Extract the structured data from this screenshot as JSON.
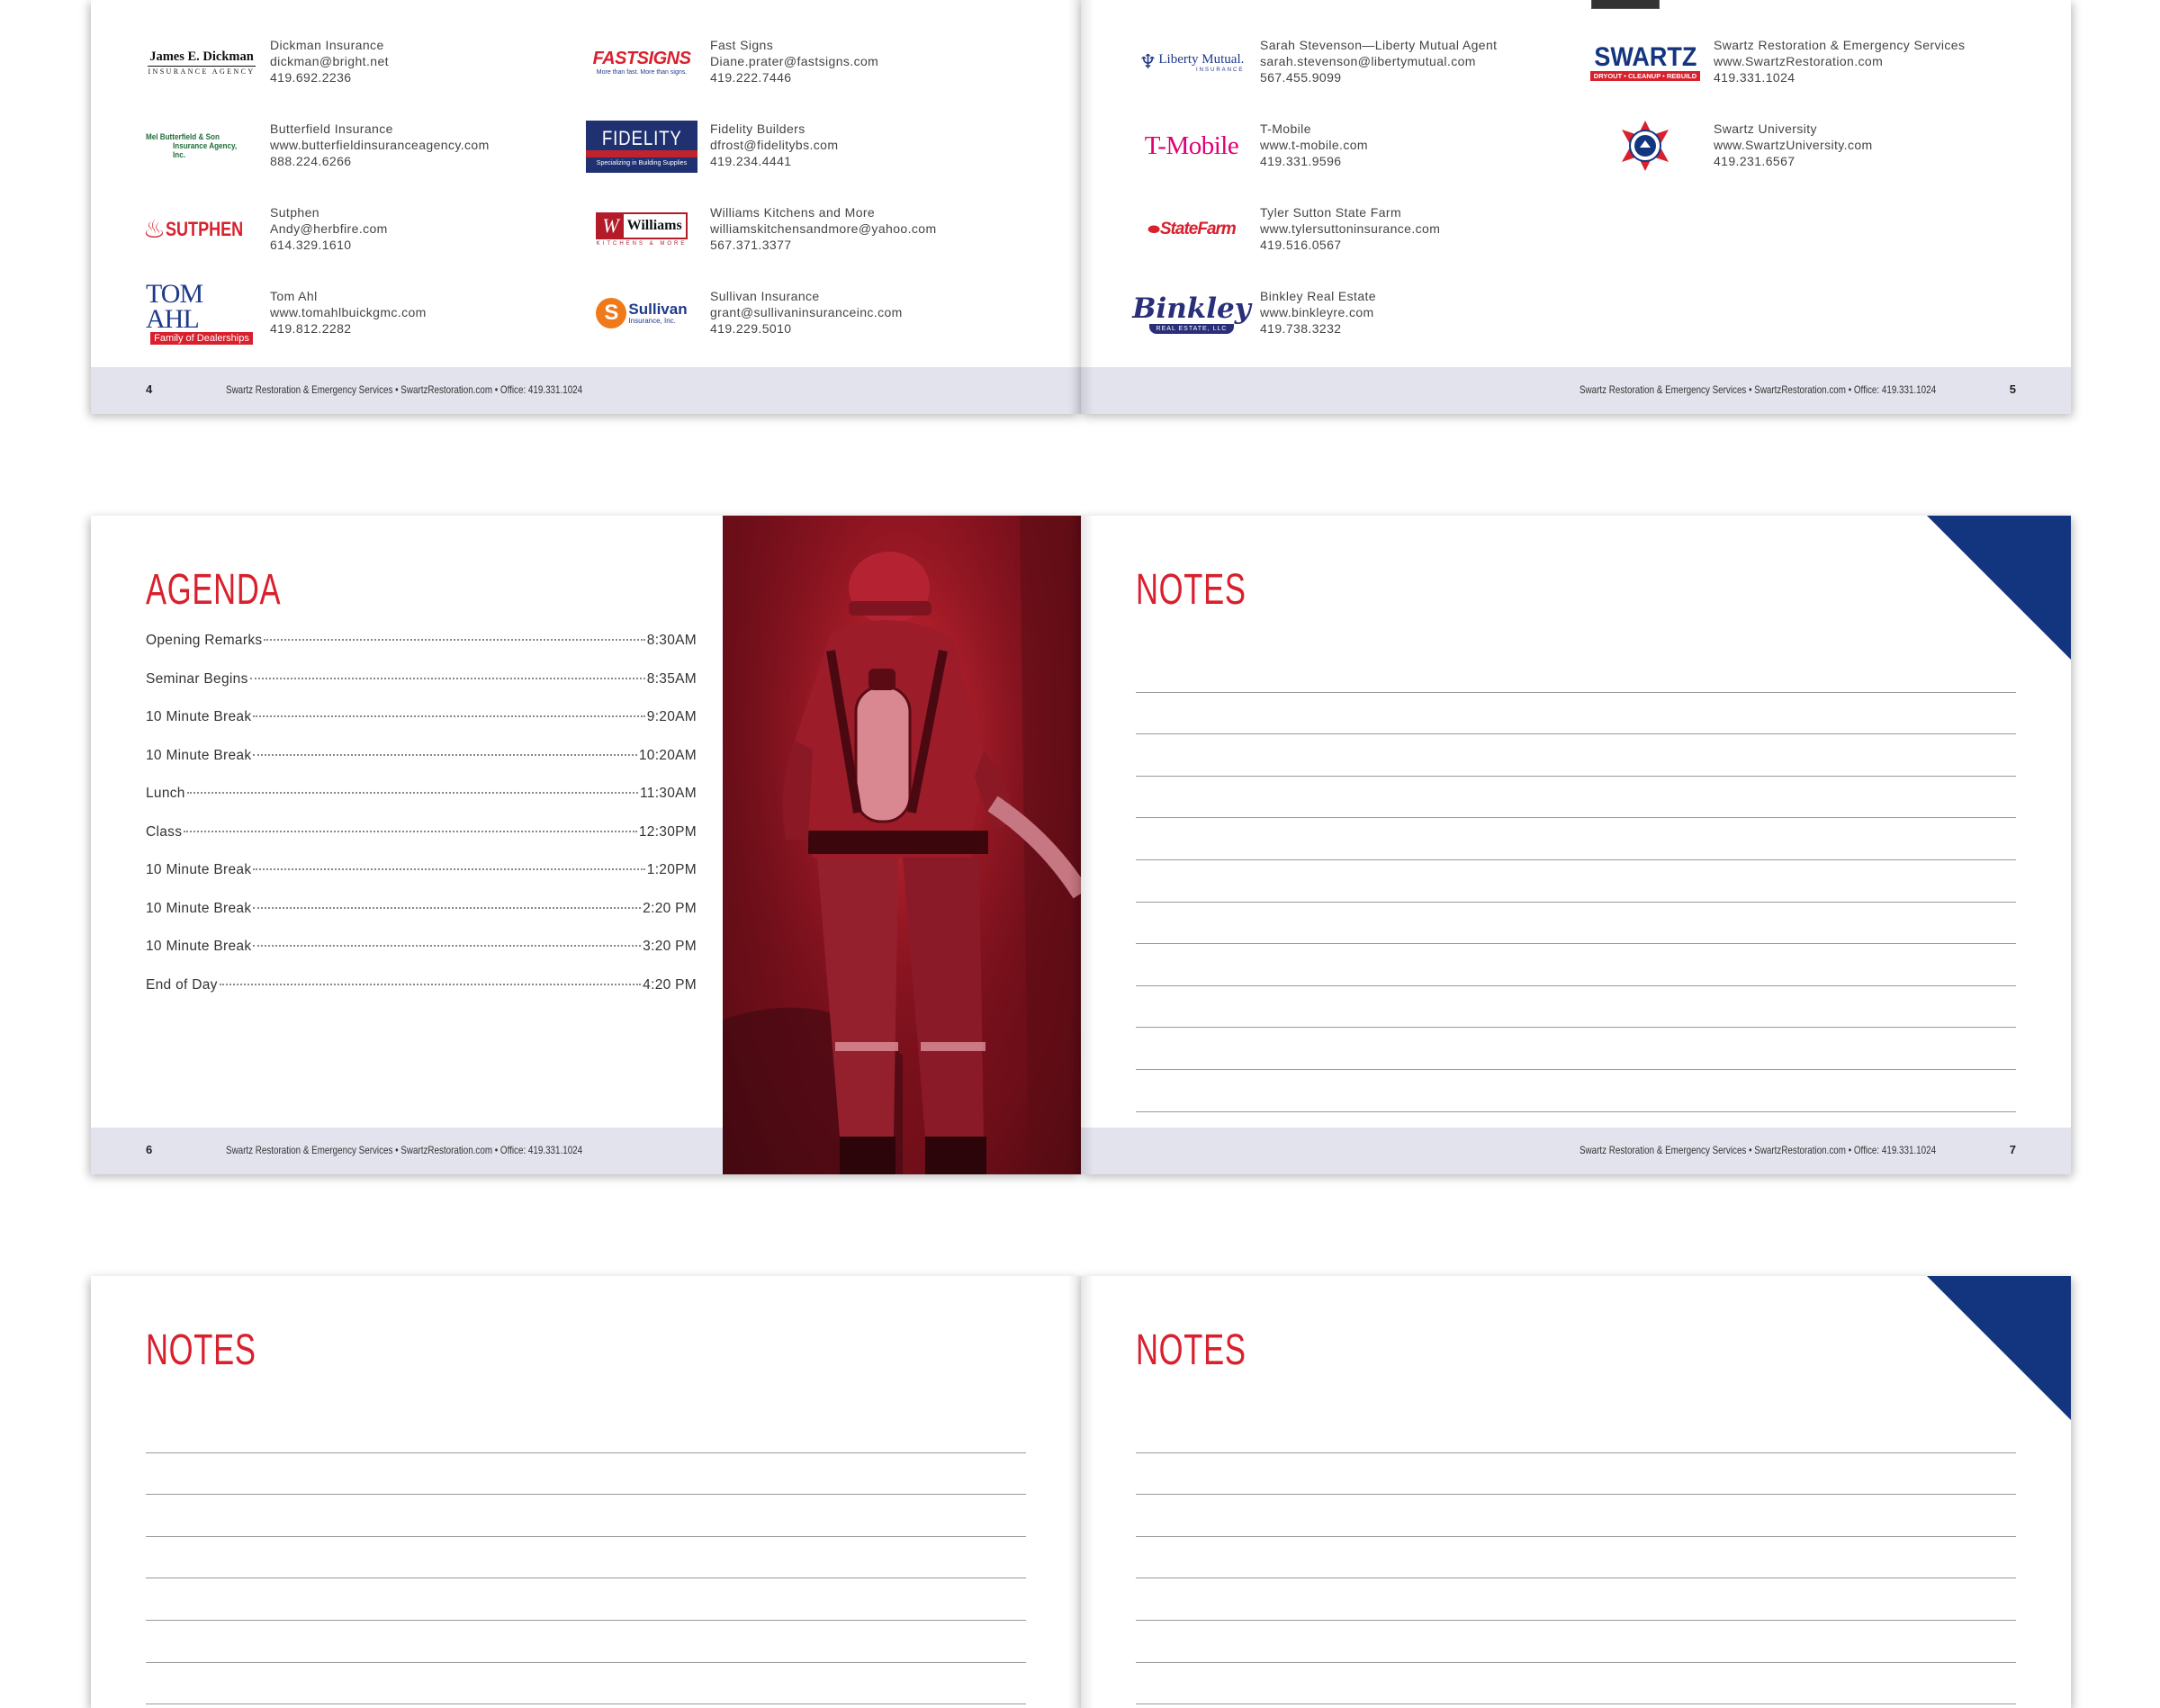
{
  "footer_text": "Swartz Restoration & Emergency Services  •  SwartzRestoration.com  •  Office: 419.331.1024",
  "spread1": {
    "left_page_number": "4",
    "right_page_number": "5",
    "left_sponsors": [
      {
        "name": "Dickman Insurance",
        "contact": "dickman@bright.net",
        "phone": "419.692.2236",
        "logo": {
          "line1": "James E. Dickman",
          "line2": "INSURANCE AGENCY"
        }
      },
      {
        "name": "Butterfield Insurance",
        "contact": "www.butterfieldinsuranceagency.com",
        "phone": "888.224.6266",
        "logo": {
          "line1": "Mel Butterfield & Son",
          "line2": "Insurance Agency, Inc."
        }
      },
      {
        "name": "Sutphen",
        "contact": "Andy@herbfire.com",
        "phone": "614.329.1610",
        "logo": {
          "line1": "SUTPHEN"
        }
      },
      {
        "name": "Tom Ahl",
        "contact": "www.tomahlbuickgmc.com",
        "phone": "419.812.2282",
        "logo": {
          "line1": "TOM AHL",
          "line2": "Family of Dealerships"
        }
      }
    ],
    "middle_sponsors": [
      {
        "name": "Fast Signs",
        "contact": "Diane.prater@fastsigns.com",
        "phone": "419.222.7446",
        "logo": {
          "line1": "FASTSIGNS",
          "line2": "More than fast. More than signs."
        }
      },
      {
        "name": "Fidelity Builders",
        "contact": "dfrost@fidelitybs.com",
        "phone": "419.234.4441",
        "logo": {
          "line1": "FIDELITY",
          "line2": "Specializing in Building Supplies"
        }
      },
      {
        "name": "Williams Kitchens and More",
        "contact": "williamskitchensandmore@yahoo.com",
        "phone": "567.371.3377",
        "logo": {
          "line1": "Williams",
          "line2": "KITCHENS & MORE"
        }
      },
      {
        "name": "Sullivan Insurance",
        "contact": "grant@sullivaninsuranceinc.com",
        "phone": "419.229.5010",
        "logo": {
          "line1": "Sullivan",
          "line2": "Insurance, Inc."
        }
      }
    ],
    "right_sponsors": [
      {
        "name": "Sarah Stevenson—Liberty Mutual Agent",
        "contact": "sarah.stevenson@libertymutual.com",
        "phone": "567.455.9099",
        "logo": {
          "line1": "Liberty Mutual.",
          "line2": "INSURANCE"
        }
      },
      {
        "name": "T-Mobile",
        "contact": "www.t-mobile.com",
        "phone": "419.331.9596",
        "logo": {
          "line1": "T-Mobile"
        }
      },
      {
        "name": "Tyler Sutton State Farm",
        "contact": "www.tylersuttoninsurance.com",
        "phone": "419.516.0567",
        "logo": {
          "line1": "StateFarm"
        }
      },
      {
        "name": "Binkley Real Estate",
        "contact": "www.binkleyre.com",
        "phone": "419.738.3232",
        "logo": {
          "line1": "Binkley",
          "line2": "REAL ESTATE, LLC"
        }
      }
    ],
    "far_right_sponsors": [
      {
        "name": "Swartz Restoration & Emergency Services",
        "contact": "www.SwartzRestoration.com",
        "phone": "419.331.1024",
        "logo": {
          "line1": "SWARTZ",
          "line2": "DRYOUT • CLEANUP • REBUILD"
        }
      },
      {
        "name": "Swartz University",
        "contact": "www.SwartzUniversity.com",
        "phone": "419.231.6567"
      }
    ]
  },
  "spread2": {
    "left_page_number": "6",
    "right_page_number": "7",
    "agenda_title": "AGENDA",
    "agenda": [
      {
        "item": "Opening Remarks",
        "time": "8:30AM"
      },
      {
        "item": "Seminar Begins",
        "time": "8:35AM"
      },
      {
        "item": "10 Minute Break",
        "time": "9:20AM"
      },
      {
        "item": "10 Minute Break",
        "time": "10:20AM"
      },
      {
        "item": "Lunch",
        "time": "11:30AM"
      },
      {
        "item": "Class",
        "time": "12:30PM"
      },
      {
        "item": "10 Minute Break",
        "time": "1:20PM"
      },
      {
        "item": "10 Minute Break",
        "time": "2:20 PM"
      },
      {
        "item": "10 Minute Break",
        "time": "3:20 PM"
      },
      {
        "item": "End of Day",
        "time": "4:20 PM"
      }
    ],
    "notes_title": "NOTES"
  },
  "spread3": {
    "left_notes_title": "NOTES",
    "right_notes_title": "NOTES"
  },
  "colors": {
    "accent_red": "#d9202d",
    "corner_blue": "#13357f",
    "footer_bg": "#e3e3ee"
  }
}
